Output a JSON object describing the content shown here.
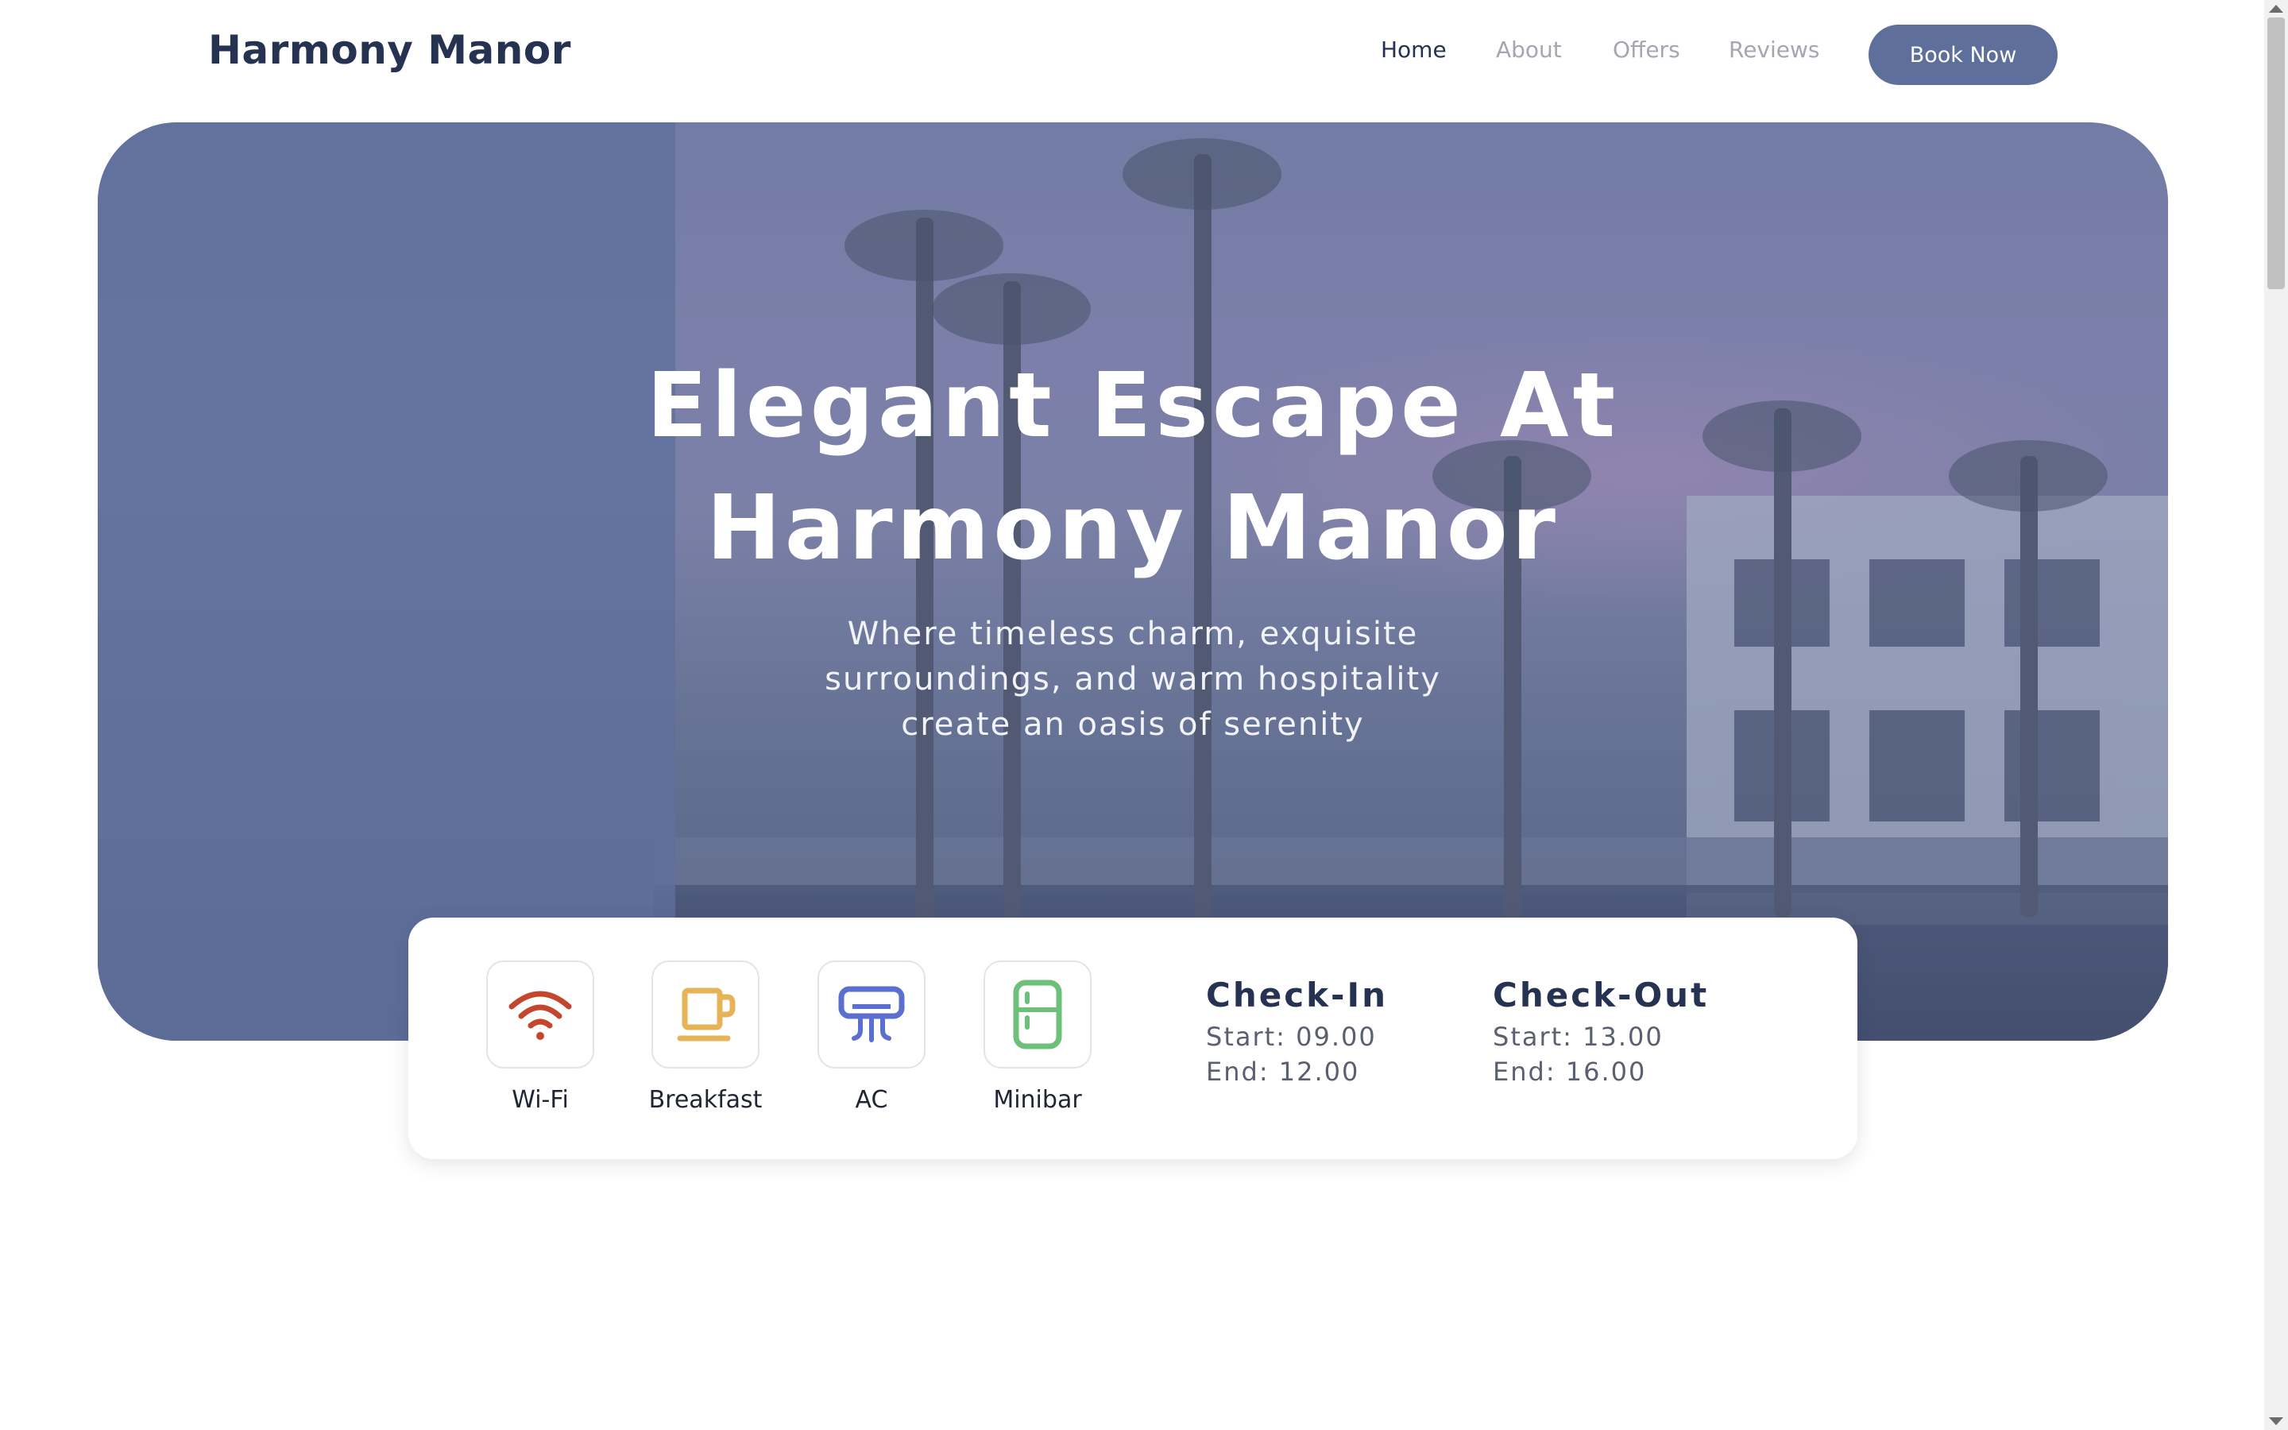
{
  "header": {
    "brand": "Harmony Manor",
    "nav": [
      "Home",
      "About",
      "Offers",
      "Reviews"
    ],
    "active_nav": "Home",
    "cta": "Book Now"
  },
  "hero": {
    "title_line1": "Elegant Escape At",
    "title_line2": "Harmony Manor",
    "subtitle_line1": "Where timeless charm, exquisite",
    "subtitle_line2": "surroundings, and warm hospitality",
    "subtitle_line3": "create an oasis of serenity"
  },
  "amenities": [
    {
      "label": "Wi-Fi",
      "icon": "wifi-icon",
      "color": "#c4462f"
    },
    {
      "label": "Breakfast",
      "icon": "coffee-cup-icon",
      "color": "#e6b357"
    },
    {
      "label": "AC",
      "icon": "air-conditioner-icon",
      "color": "#5a6fd0"
    },
    {
      "label": "Minibar",
      "icon": "fridge-icon",
      "color": "#6cc07a"
    }
  ],
  "checkin": {
    "title": "Check-In",
    "start": "Start: 09.00",
    "end": "End: 12.00"
  },
  "checkout": {
    "title": "Check-Out",
    "start": "Start: 13.00",
    "end": "End: 16.00"
  },
  "colors": {
    "accent": "#5e6f9c",
    "brand_text": "#253251",
    "nav_inactive": "#a5a7b0"
  }
}
